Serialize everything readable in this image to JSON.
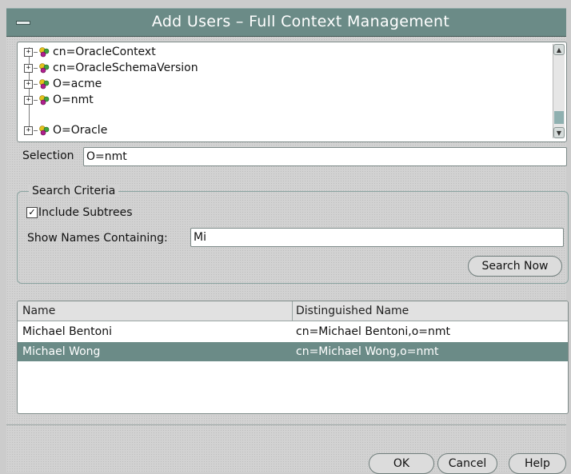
{
  "window": {
    "title": "Add Users – Full Context Management"
  },
  "tree": {
    "items": [
      {
        "label": "cn=OracleContext"
      },
      {
        "label": "cn=OracleSchemaVersion"
      },
      {
        "label": "O=acme"
      },
      {
        "label": "O=nmt"
      },
      {
        "label": "O=Oracle"
      }
    ]
  },
  "selection": {
    "label": "Selection",
    "value": "O=nmt"
  },
  "search": {
    "group_title": "Search Criteria",
    "include_subtrees_label": "Include Subtrees",
    "include_subtrees_checked": true,
    "names_label": "Show Names Containing:",
    "names_value": "Mi",
    "search_button": "Search Now"
  },
  "results": {
    "columns": [
      "Name",
      "Distinguished Name"
    ],
    "rows": [
      {
        "name": "Michael Bentoni",
        "dn": "cn=Michael Bentoni,o=nmt",
        "selected": false
      },
      {
        "name": "Michael Wong",
        "dn": "cn=Michael Wong,o=nmt",
        "selected": true
      }
    ]
  },
  "buttons": {
    "ok": "OK",
    "cancel": "Cancel",
    "help": "Help"
  },
  "colors": {
    "titlebar": "#6b8b87",
    "selection": "#6b8b87"
  },
  "icons": {
    "tree_node": "directory-node-icon",
    "expander": "plus-expander-icon"
  }
}
